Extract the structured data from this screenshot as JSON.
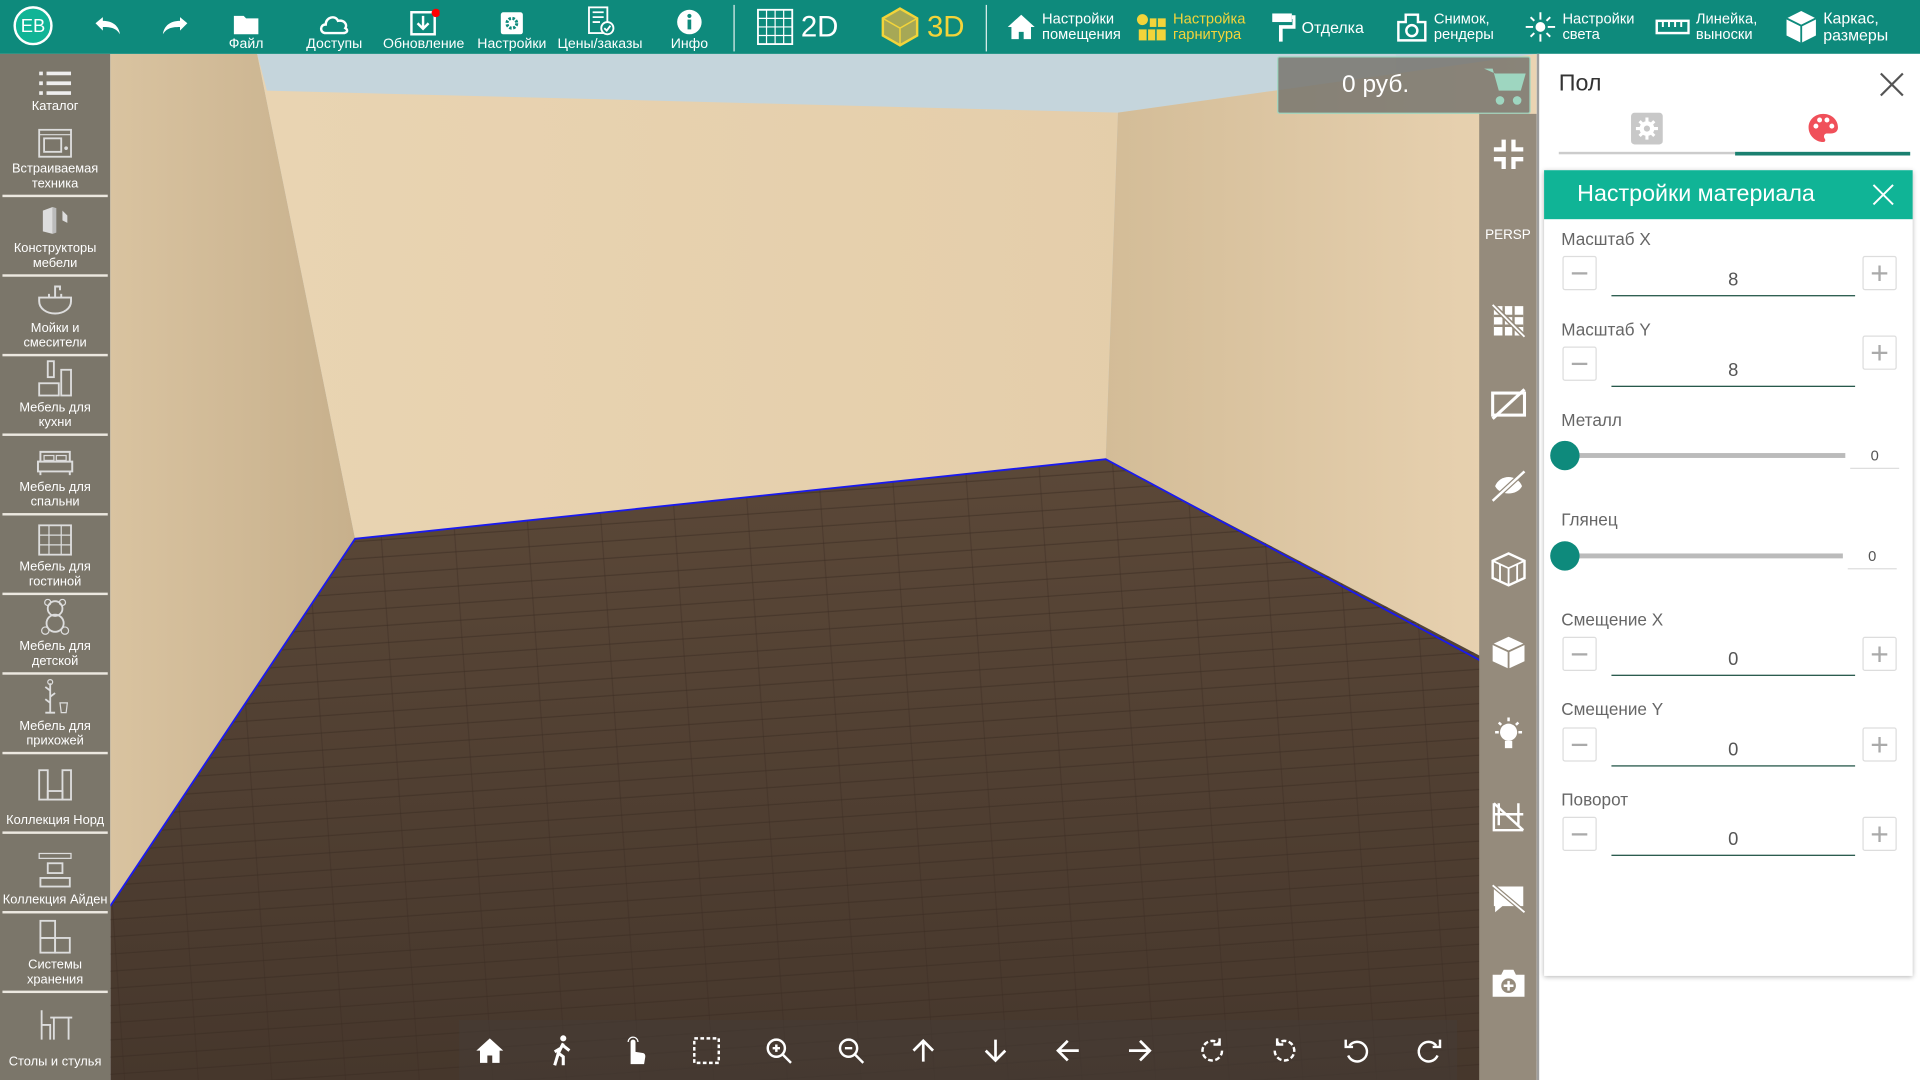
{
  "topbar": {
    "avatar": "ЕВ",
    "items": [
      {
        "label": "Файл",
        "icon": "folder-icon"
      },
      {
        "label": "Доступы",
        "icon": "cloud-icon"
      },
      {
        "label": "Обновление",
        "icon": "download-icon"
      },
      {
        "label": "Настройки",
        "icon": "settings-icon"
      },
      {
        "label": "Цены/заказы",
        "icon": "price-list-icon"
      },
      {
        "label": "Инфо",
        "icon": "info-icon"
      }
    ],
    "view2d": "2D",
    "view3d": "3D",
    "active_view": "3D",
    "room_settings": [
      "Настройки",
      "помещения"
    ],
    "set_settings": [
      "Настройка",
      "гарнитура"
    ],
    "finish": "Отделка",
    "snapshot": [
      "Снимок,",
      "рендеры"
    ],
    "light": [
      "Настройки",
      "света"
    ],
    "ruler": [
      "Линейка,",
      "выноски"
    ],
    "frame": [
      "Каркас,",
      "размеры"
    ]
  },
  "sidebar": {
    "items": [
      {
        "label": "Каталог",
        "icon": "list-icon"
      },
      {
        "label": "Встраиваемая техника",
        "icon": "oven-icon"
      },
      {
        "label": "Конструкторы мебели",
        "icon": "cabinet-builder-icon"
      },
      {
        "label": "Мойки и смесители",
        "icon": "sink-icon"
      },
      {
        "label": "Мебель для кухни",
        "icon": "kitchen-icon"
      },
      {
        "label": "Мебель для спальни",
        "icon": "bed-icon"
      },
      {
        "label": "Мебель для гостиной",
        "icon": "wall-unit-icon"
      },
      {
        "label": "Мебель для детской",
        "icon": "teddy-bear-icon"
      },
      {
        "label": "Мебель для прихожей",
        "icon": "coat-rack-icon"
      },
      {
        "label": "Коллекция Норд",
        "icon": "shelving-icon"
      },
      {
        "label": "Коллекция Айден",
        "icon": "tv-stand-icon"
      },
      {
        "label": "Системы хранения",
        "icon": "storage-icon"
      },
      {
        "label": "Столы и стулья",
        "icon": "table-chair-icon"
      }
    ]
  },
  "price": {
    "value": "0 руб.",
    "icon": "cart-icon"
  },
  "right_toolbar": {
    "persp": "PERSP"
  },
  "panel": {
    "title": "Пол",
    "tabs": [
      {
        "icon": "gear-icon",
        "active": false
      },
      {
        "icon": "palette-icon",
        "active": true
      }
    ],
    "material": {
      "title": "Настройки материала",
      "scale_x": {
        "label": "Масштаб X",
        "value": "8"
      },
      "scale_y": {
        "label": "Масштаб Y",
        "value": "8"
      },
      "metal": {
        "label": "Металл",
        "value": "0",
        "level": 0
      },
      "gloss": {
        "label": "Глянец",
        "value": "0",
        "level": 0
      },
      "offset_x": {
        "label": "Смещение X",
        "value": "0"
      },
      "offset_y": {
        "label": "Смещение Y",
        "value": "0"
      },
      "rotation": {
        "label": "Поворот",
        "value": "0"
      }
    }
  },
  "colors": {
    "brand": "#0e8a7c",
    "header": "#10b496",
    "accent_yellow": "#f3d43a",
    "palette": "#f0505a"
  }
}
